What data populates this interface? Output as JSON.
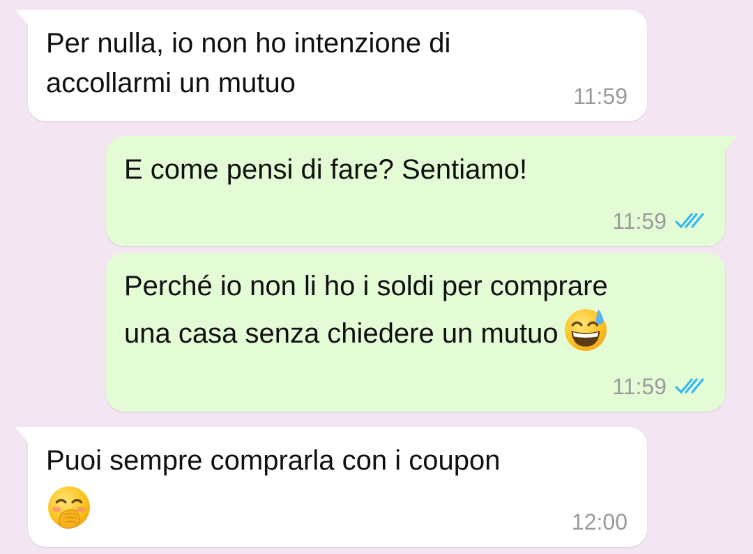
{
  "colors": {
    "background": "#f3e5f1",
    "incoming_bubble": "#ffffff",
    "outgoing_bubble": "#e4fcd6",
    "timestamp": "#9a9a9a",
    "read_ticks": "#34b7f1"
  },
  "messages": [
    {
      "direction": "incoming",
      "lines": [
        "Per nulla, io non ho intenzione di",
        "accollarmi un mutuo"
      ],
      "time": "11:59"
    },
    {
      "direction": "outgoing",
      "lines": [
        "E come pensi di fare? Sentiamo!"
      ],
      "time": "11:59",
      "status_icon": "double-check-read-icon"
    },
    {
      "direction": "outgoing",
      "lines": [
        "Perché io non li ho i soldi per comprare",
        "una casa senza chiedere un mutuo"
      ],
      "emoji": "grinning-face-with-sweat-emoji",
      "time": "11:59",
      "status_icon": "double-check-read-icon"
    },
    {
      "direction": "incoming",
      "lines": [
        "Puoi sempre comprarla con i coupon"
      ],
      "emoji": "face-with-hand-over-mouth-emoji",
      "time": "12:00"
    }
  ]
}
